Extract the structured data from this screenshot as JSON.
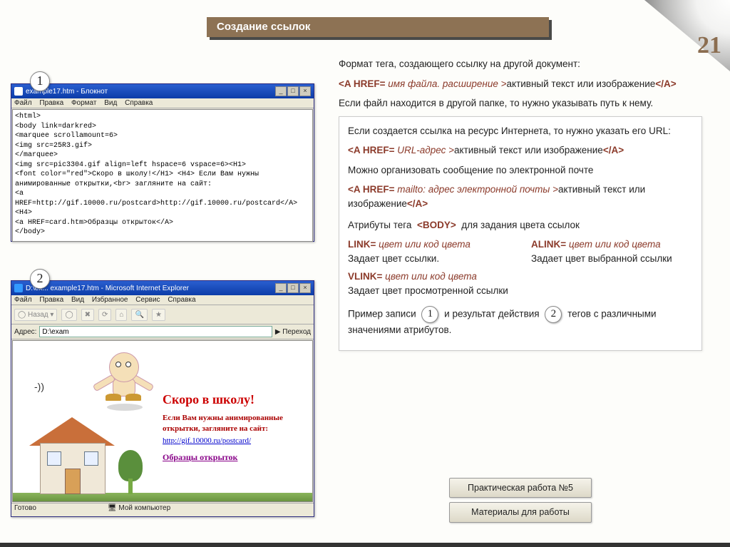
{
  "page_number": "21",
  "title": "Создание ссылок",
  "badges": {
    "one": "1",
    "two": "2"
  },
  "notepad": {
    "title": "example17.htm - Блокнот",
    "menu": [
      "Файл",
      "Правка",
      "Формат",
      "Вид",
      "Справка"
    ],
    "content": "<html>\n<body link=darkred>\n<marquee scrollamount=6>\n<img src=25R3.gif>\n</marquee>\n<img src=pic3304.gif align=left hspace=6 vspace=6><H1>\n<font color=\"red\">Скоро в школу!</H1> <H4> Если Вам нужны\nанимированные открытки,<br> загляните на сайт:\n<a HREF=http://gif.10000.ru/postcard>http://gif.10000.ru/postcard</A><H4>\n<a HREF=card.htm>Образцы открыток</A>\n</body>"
  },
  "ie": {
    "title": "D:\\ex... example17.htm - Microsoft Internet Explorer",
    "menu": [
      "Файл",
      "Правка",
      "Вид",
      "Избранное",
      "Сервис",
      "Справка"
    ],
    "toolbar": {
      "back": "Назад"
    },
    "addr_label": "Адрес:",
    "addr_value": "D:\\exam",
    "go": "Переход",
    "content": {
      "heading": "Скоро в школу!",
      "para": "Если Вам нужны анимированные открытки, загляните на сайт:",
      "link1": "http://gif.10000.ru/postcard/",
      "link2": "Образцы открыток"
    },
    "status_ready": "Готово",
    "status_zone": "Мой компьютер"
  },
  "right": {
    "p1a": "Формат тега, создающего ссылку на другой документ:",
    "fmt1_open": "<A HREF=",
    "fmt1_arg": " имя файла. расширение >",
    "fmt1_body": "активный текст или изображение",
    "fmt1_close": "</A>",
    "p2": "Если файл находится в другой папке, то нужно указывать путь к нему.",
    "box_p1": "Если создается ссылка на ресурс Интернета, то нужно указать его URL:",
    "box_fmt2_open": "<A HREF=",
    "box_fmt2_arg": " URL-адрес >",
    "box_fmt2_body": "активный текст или изображение",
    "box_fmt2_close": "</A>",
    "box_p2": "Можно организовать сообщение по электронной почте",
    "box_fmt3_open": "<A HREF=",
    "box_fmt3_arg": " mailto: адрес электронной почты >",
    "box_fmt3_body": "активный текст или изображение",
    "box_fmt3_close": "</A>",
    "box_h": "Атрибуты тега  <BODY>  для задания цвета ссылок",
    "link_attr": "LINK=",
    "link_val": " цвет или код цвета",
    "link_desc": "Задает цвет ссылки.",
    "alink_attr": "ALINK=",
    "alink_val": " цвет или код цвета",
    "alink_desc": "Задает цвет выбранной ссылки",
    "vlink_attr": "VLINK=",
    "vlink_val": " цвет или код цвета",
    "vlink_desc": "Задает цвет просмотренной ссылки",
    "final_a": "Пример записи",
    "final_b": "и результат действия",
    "final_c": "тегов с различными значениями атрибутов."
  },
  "nav": {
    "btn1": "Практическая работа №5",
    "btn2": "Материалы для работы"
  }
}
